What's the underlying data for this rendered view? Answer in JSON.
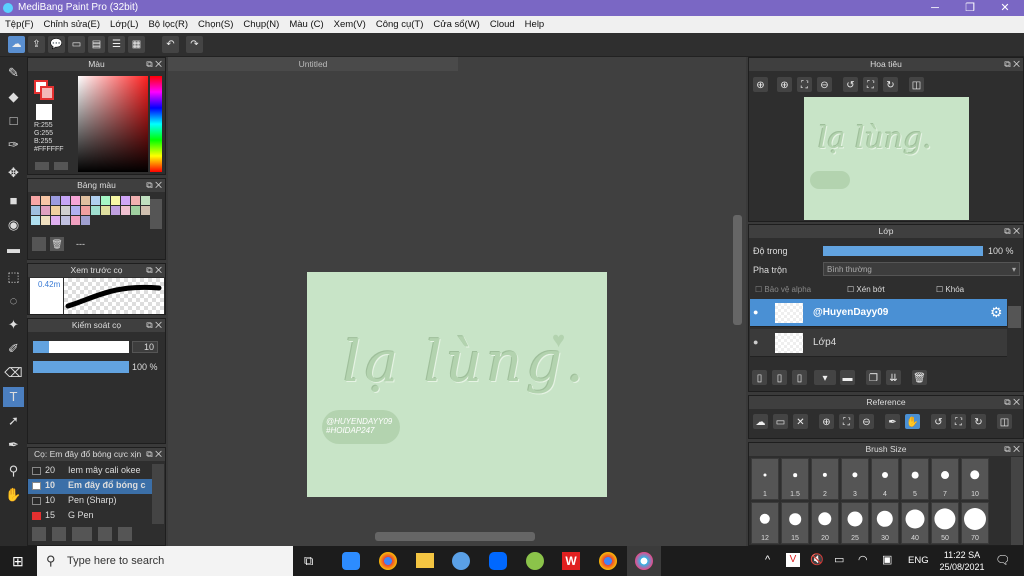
{
  "app": {
    "title": "MediBang Paint Pro (32bit)",
    "doc_title": "Untitled"
  },
  "menu": [
    "Tệp(F)",
    "Chỉnh sửa(E)",
    "Lớp(L)",
    "Bộ lọc(R)",
    "Chọn(S)",
    "Chụp(N)",
    "Màu (C)",
    "Xem(V)",
    "Công cụ(T)",
    "Cửa sổ(W)",
    "Cloud",
    "Help"
  ],
  "panels": {
    "color": "Màu",
    "palette": "Bảng màu",
    "brush_preview": "Xem trước cọ",
    "brush_control": "Kiểm soát cọ",
    "brushes": "Cọ: Em đây đổ bóng cực xịn",
    "navigator": "Hoa tiêu",
    "layer": "Lớp",
    "reference": "Reference",
    "brush_size": "Brush Size"
  },
  "color": {
    "r": "R:255",
    "g": "G:255",
    "b": "B:255",
    "hex": "#FFFFFF",
    "primary": "#ffffff",
    "accent": "#e53030"
  },
  "palette_extra": "---",
  "brush_preview": {
    "size": "0.42m"
  },
  "brush_control": {
    "size": "10",
    "opacity": "100 %"
  },
  "brush_list": [
    {
      "size": "20",
      "name": "Iem mây cali okee",
      "color": "#2a2a2a"
    },
    {
      "size": "10",
      "name": "Em đây đổ bóng c",
      "color": "#ffffff"
    },
    {
      "size": "10",
      "name": "Pen (Sharp)",
      "color": "#2a2a2a"
    },
    {
      "size": "15",
      "name": "G Pen",
      "color": "#e53030"
    }
  ],
  "canvas_text": {
    "main": "lạ lùng.",
    "tag1": "@HUYENDAYY09",
    "tag2": "#HOIDAP247"
  },
  "layer": {
    "opacity_label": "Độ trong",
    "opacity_value": "100 %",
    "blend_label": "Pha trộn",
    "blend_value": "Bình thường",
    "protect_alpha": "Bảo vệ alpha",
    "clip": "Xén bớt",
    "lock": "Khóa",
    "layers": [
      {
        "name": "@HuyenDayy09"
      },
      {
        "name": "Lớp4"
      }
    ]
  },
  "brush_sizes": [
    "1",
    "1.5",
    "2",
    "3",
    "4",
    "5",
    "7",
    "10",
    "12",
    "15",
    "20",
    "25",
    "30",
    "40",
    "50",
    "70"
  ],
  "taskbar": {
    "search": "Type here to search",
    "lang": "ENG",
    "time": "11:22 SA",
    "date": "25/08/2021"
  }
}
